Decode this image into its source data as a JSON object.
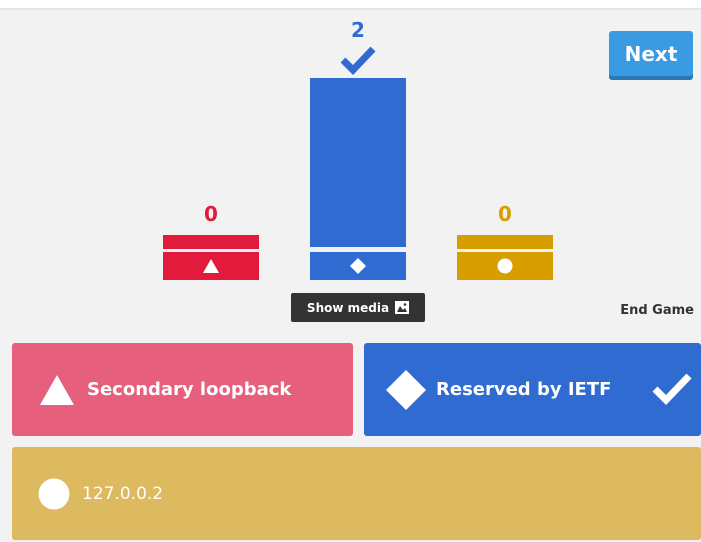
{
  "header": {
    "next_label": "Next"
  },
  "results": [
    {
      "shape": "triangle-icon",
      "color": "#e21b3c",
      "count": "0",
      "correct": false
    },
    {
      "shape": "diamond-icon",
      "color": "#2f6bd0",
      "count": "2",
      "correct": true
    },
    {
      "shape": "circle-icon",
      "color": "#d89e00",
      "count": "0",
      "correct": false
    }
  ],
  "show_media": {
    "label": "Show media",
    "icon": "image-icon"
  },
  "end_game_label": "End Game",
  "answers": [
    {
      "shape": "triangle-icon",
      "text": "Secondary loopback",
      "color": "#e65f7c",
      "correct": false
    },
    {
      "shape": "diamond-icon",
      "text": "Reserved by IETF",
      "color": "#2f6bd0",
      "correct": true
    },
    {
      "shape": "circle-icon",
      "text": "127.0.0.2",
      "color": "#ddb95f",
      "correct": false
    }
  ]
}
